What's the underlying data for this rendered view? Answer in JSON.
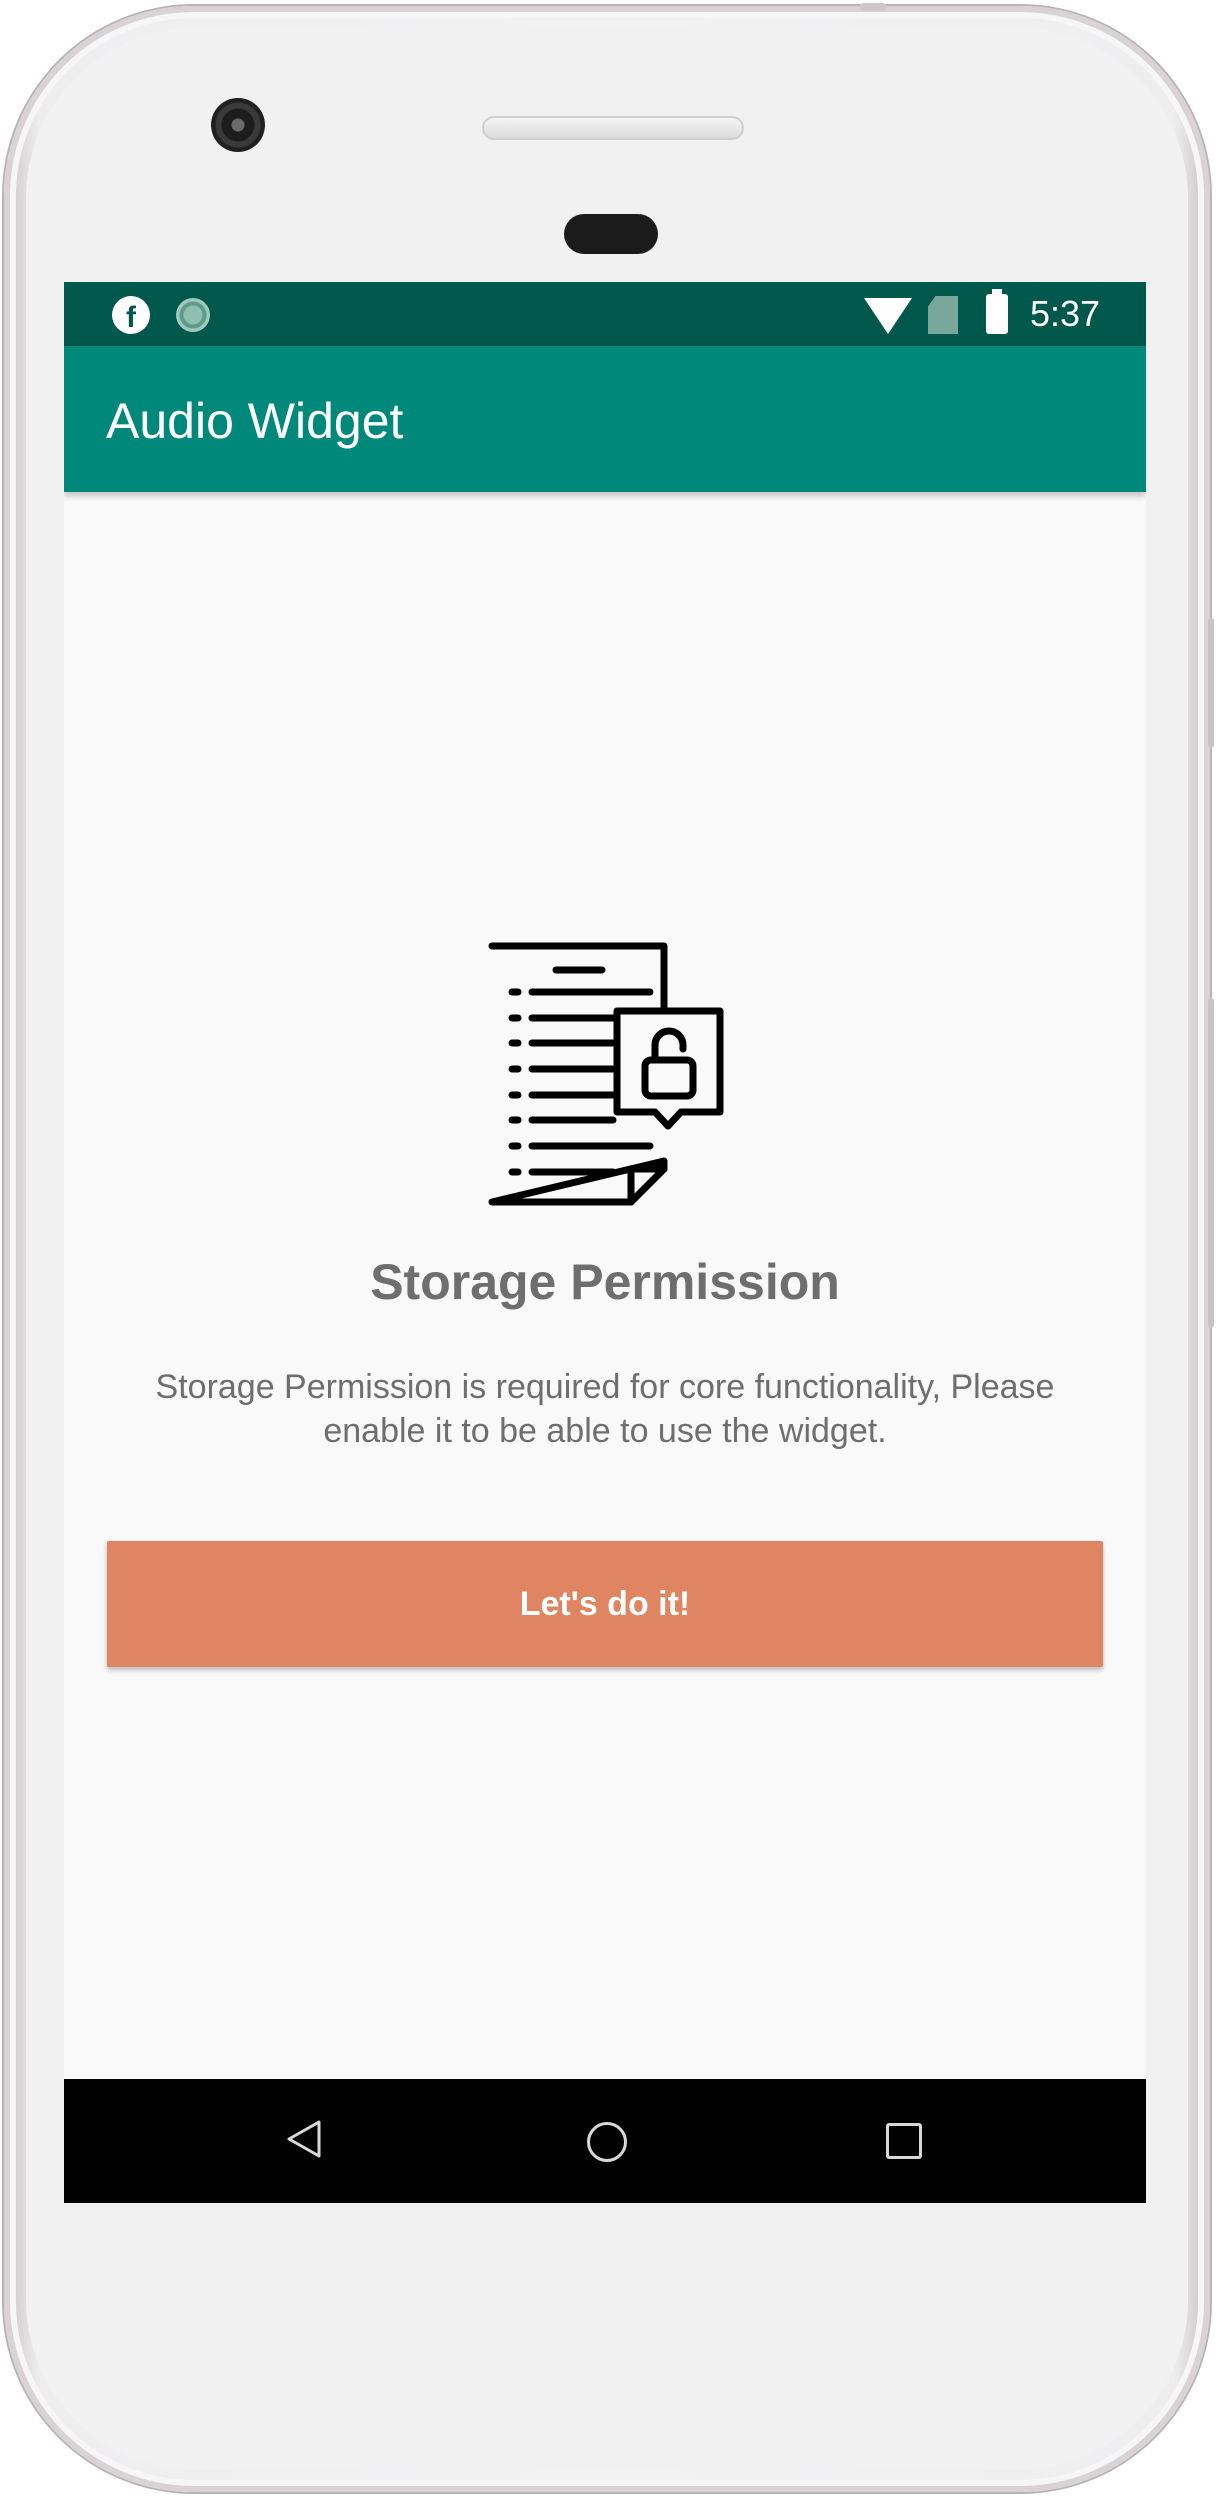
{
  "status_bar": {
    "time": "5:37",
    "icons": [
      "facebook-icon",
      "sync-icon",
      "wifi-icon",
      "no-sim-icon",
      "battery-charging-icon"
    ]
  },
  "app_bar": {
    "title": "Audio Widget"
  },
  "permission": {
    "icon": "document-lock-icon",
    "title": "Storage Permission",
    "description": "Storage Permission is required for core functionality, Please enable it to be able to use the widget.",
    "button_label": "Let's do it!"
  },
  "nav_bar": {
    "icons": [
      "back-icon",
      "home-icon",
      "recents-icon"
    ]
  },
  "colors": {
    "status_bar": "#00574b",
    "app_bar": "#00897b",
    "accent_button": "#df8562",
    "text_gray": "#6e6e6e"
  }
}
